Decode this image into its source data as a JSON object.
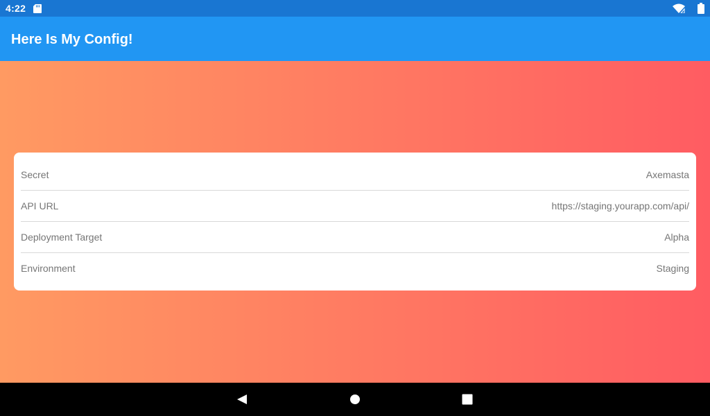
{
  "status_bar": {
    "time": "4:22",
    "icons": [
      "sd-card-icon",
      "wifi-icon",
      "battery-icon"
    ]
  },
  "app_bar": {
    "title": "Here Is My Config!",
    "color": "#2196F3"
  },
  "background": {
    "gradient_start": "#FF9A62",
    "gradient_end": "#FF5C62"
  },
  "config": {
    "rows": [
      {
        "label": "Secret",
        "value": "Axemasta"
      },
      {
        "label": "API URL",
        "value": "https://staging.yourapp.com/api/"
      },
      {
        "label": "Deployment Target",
        "value": "Alpha"
      },
      {
        "label": "Environment",
        "value": "Staging"
      }
    ]
  },
  "nav_bar": {
    "buttons": [
      "back-icon",
      "home-icon",
      "recents-icon"
    ]
  }
}
